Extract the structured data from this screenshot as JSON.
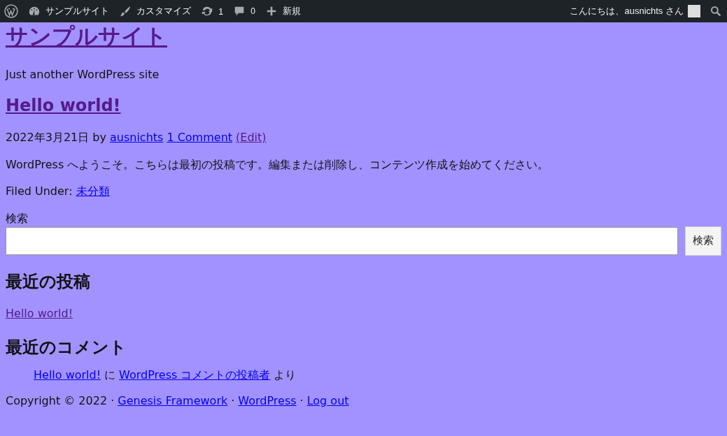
{
  "admin_bar": {
    "items": [
      {
        "kind": "site",
        "label": "サンプルサイト"
      },
      {
        "kind": "customize",
        "label": "カスタマイズ"
      },
      {
        "kind": "updates",
        "label": "1"
      },
      {
        "kind": "comments",
        "label": "0"
      },
      {
        "kind": "new",
        "label": "新規"
      }
    ],
    "greeting": "こんにちは、ausnichts さん"
  },
  "site_title": {
    "text": "サンプルサイト",
    "visited": true
  },
  "site_description": "Just another WordPress site",
  "post": {
    "title": {
      "text": "Hello world!",
      "visited": true
    },
    "meta": [
      {
        "kind": "text",
        "text": "2022年3月21日 by"
      },
      {
        "kind": "link",
        "text": "ausnichts",
        "visited": false
      },
      {
        "kind": "link",
        "text": "1 Comment",
        "visited": false
      },
      {
        "kind": "link",
        "text": "(Edit)",
        "visited": true
      }
    ],
    "content": "WordPress へようこそ。こちらは最初の投稿です。編集または削除し、コンテンツ作成を始めてください。",
    "filed_under": [
      {
        "kind": "text",
        "text": "Filed Under:"
      },
      {
        "kind": "link",
        "text": "未分類",
        "visited": false
      }
    ]
  },
  "search_widget": {
    "label": "検索",
    "button": "検索"
  },
  "recent_posts": {
    "heading": "最近の投稿",
    "items": [
      {
        "text": "Hello world!",
        "visited": true
      }
    ]
  },
  "recent_comments": {
    "heading": "最近のコメント",
    "items": [
      [
        {
          "kind": "link",
          "text": "Hello world!",
          "visited": false
        },
        {
          "kind": "text",
          "text": "に"
        },
        {
          "kind": "link",
          "text": "WordPress コメントの投稿者",
          "visited": false
        },
        {
          "kind": "text",
          "text": "より"
        }
      ]
    ]
  },
  "footer": [
    {
      "kind": "text",
      "text": "Copyright © 2022 ·"
    },
    {
      "kind": "link",
      "text": "Genesis Framework",
      "visited": false
    },
    {
      "kind": "text",
      "text": "·"
    },
    {
      "kind": "link",
      "text": "WordPress",
      "visited": false
    },
    {
      "kind": "text",
      "text": "·"
    },
    {
      "kind": "link",
      "text": "Log out",
      "visited": false
    }
  ]
}
